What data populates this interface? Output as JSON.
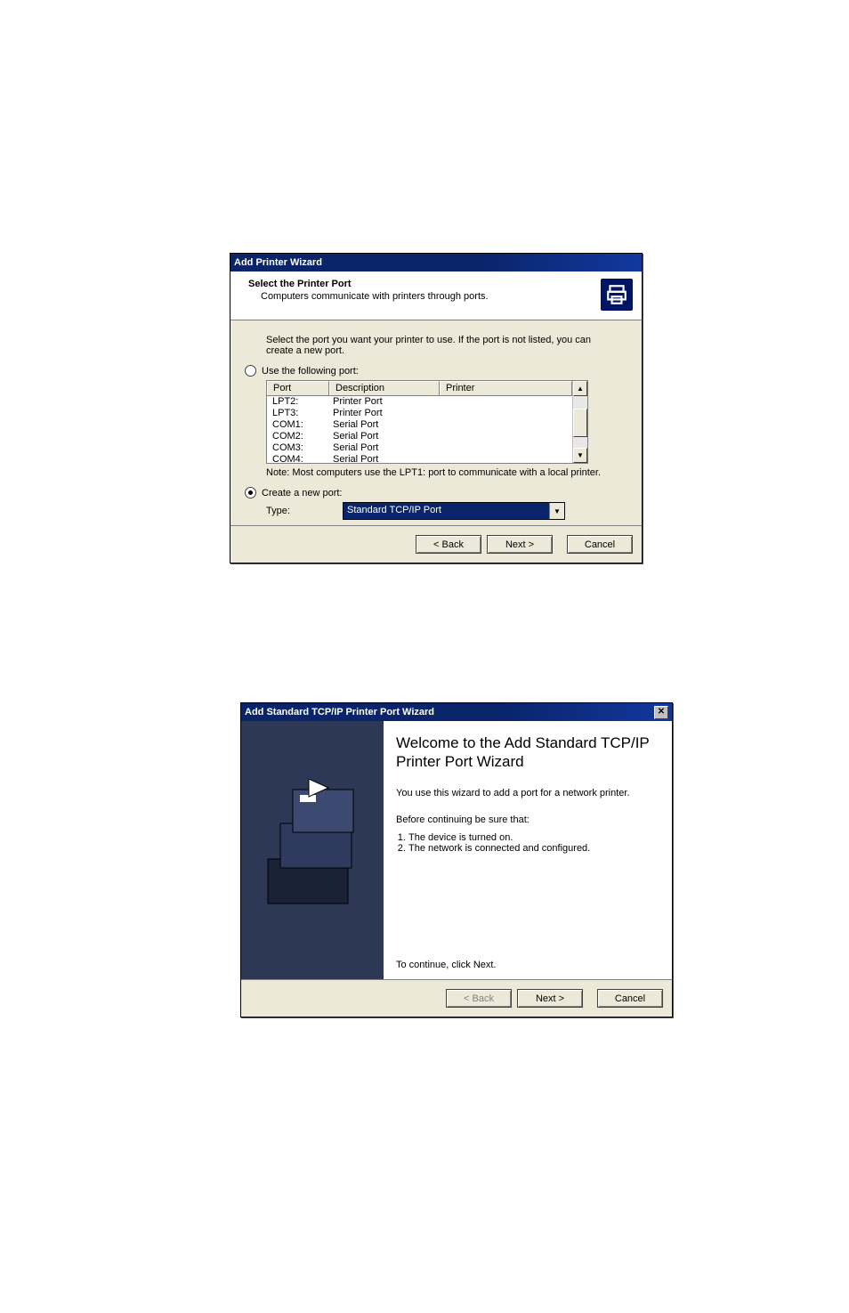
{
  "dialog1": {
    "title": "Add Printer Wizard",
    "header_title": "Select the Printer Port",
    "header_sub": "Computers communicate with printers through ports.",
    "instruction": "Select the port you want your printer to use.  If the port is not listed, you can create a new port.",
    "radio_use_label": "Use the following port:",
    "radio_create_label": "Create a new port:",
    "table": {
      "headers": {
        "port": "Port",
        "description": "Description",
        "printer": "Printer"
      },
      "rows": [
        {
          "port": "LPT2:",
          "description": "Printer Port",
          "printer": ""
        },
        {
          "port": "LPT3:",
          "description": "Printer Port",
          "printer": ""
        },
        {
          "port": "COM1:",
          "description": "Serial Port",
          "printer": ""
        },
        {
          "port": "COM2:",
          "description": "Serial Port",
          "printer": ""
        },
        {
          "port": "COM3:",
          "description": "Serial Port",
          "printer": ""
        },
        {
          "port": "COM4:",
          "description": "Serial Port",
          "printer": ""
        }
      ]
    },
    "note": "Note: Most computers use the LPT1: port to communicate with a local printer.",
    "type_label": "Type:",
    "type_value": "Standard TCP/IP Port",
    "buttons": {
      "back": "< Back",
      "next": "Next >",
      "cancel": "Cancel"
    }
  },
  "dialog2": {
    "title": "Add Standard TCP/IP Printer Port Wizard",
    "heading": "Welcome to the Add Standard TCP/IP Printer Port Wizard",
    "intro": "You use this wizard to add a port for a network printer.",
    "before": "Before continuing be sure that:",
    "point1": "The device is turned on.",
    "point2": "The network is connected and configured.",
    "continue": "To continue, click Next.",
    "buttons": {
      "back": "< Back",
      "next": "Next >",
      "cancel": "Cancel"
    }
  }
}
